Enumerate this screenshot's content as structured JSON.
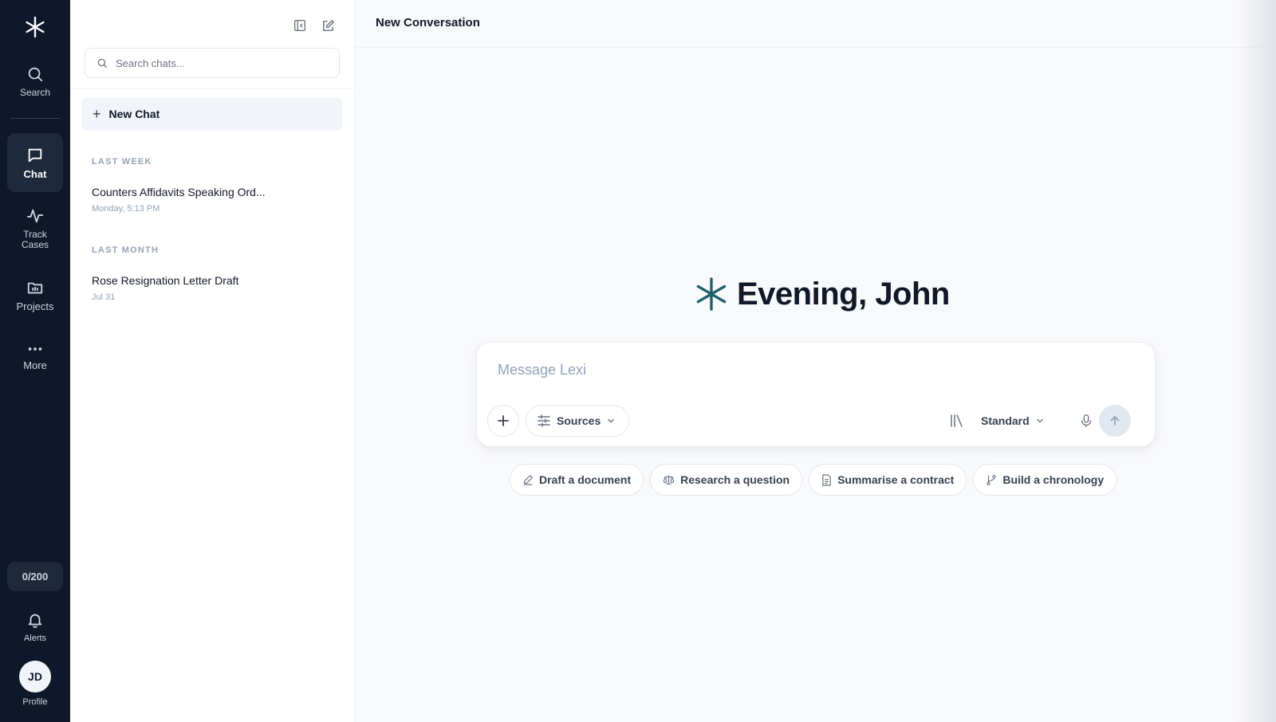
{
  "rail": {
    "search_label": "Search",
    "chat_label": "Chat",
    "track_label": "Track Cases",
    "projects_label": "Projects",
    "more_label": "More",
    "usage": "0/200",
    "alerts_label": "Alerts",
    "profile_initials": "JD",
    "profile_label": "Profile"
  },
  "sidebar": {
    "search_placeholder": "Search chats...",
    "new_chat_label": "New Chat",
    "groups": [
      {
        "label": "LAST WEEK",
        "items": [
          {
            "title": "Counters Affidavits Speaking Ord...",
            "time": "Monday, 5:13 PM"
          }
        ]
      },
      {
        "label": "LAST MONTH",
        "items": [
          {
            "title": "Rose Resignation Letter Draft",
            "time": "Jul 31"
          }
        ]
      }
    ]
  },
  "main": {
    "title": "New Conversation",
    "greeting": "Evening, John",
    "composer": {
      "placeholder": "Message Lexi",
      "sources_label": "Sources",
      "mode_label": "Standard"
    },
    "suggestions": [
      {
        "label": "Draft a document",
        "icon": "pencil-icon"
      },
      {
        "label": "Research a question",
        "icon": "scale-icon"
      },
      {
        "label": "Summarise a contract",
        "icon": "document-icon"
      },
      {
        "label": "Build a chronology",
        "icon": "branch-icon"
      }
    ]
  },
  "colors": {
    "rail_bg": "#0f172a",
    "brand_teal": "#1f5f6e",
    "page_bg": "#f8f9fb"
  }
}
